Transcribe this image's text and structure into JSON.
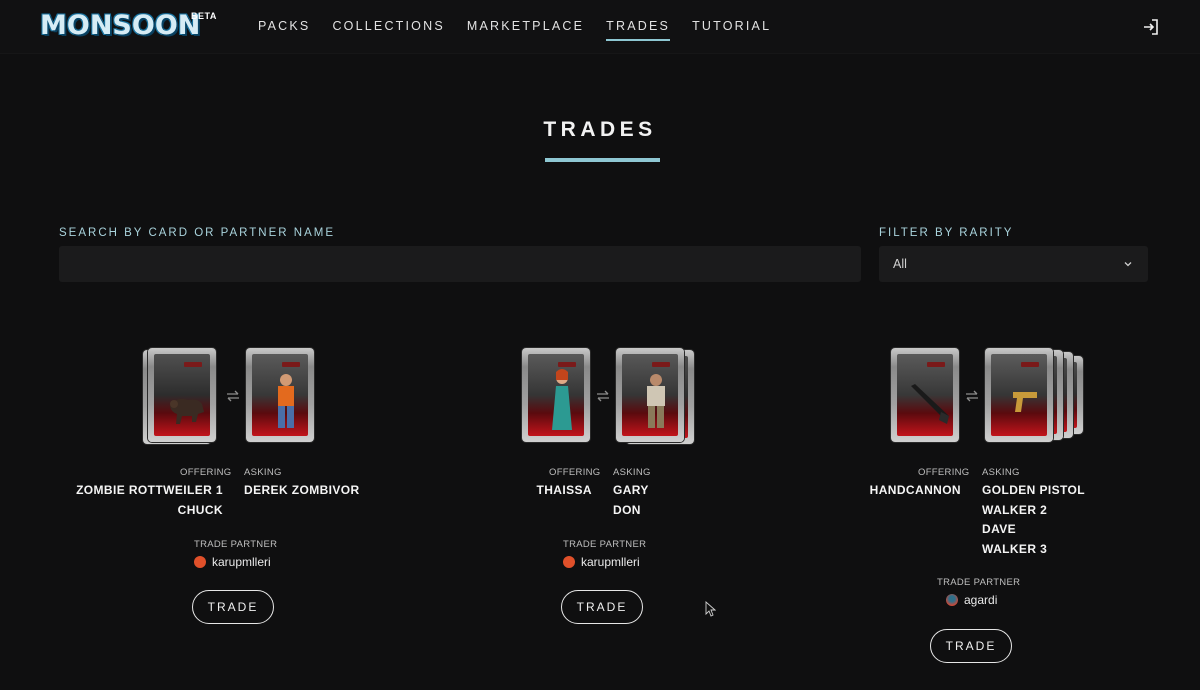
{
  "header": {
    "logo": "MONSOON",
    "beta": "BETA",
    "nav": [
      {
        "label": "PACKS",
        "active": false
      },
      {
        "label": "COLLECTIONS",
        "active": false
      },
      {
        "label": "MARKETPLACE",
        "active": false
      },
      {
        "label": "TRADES",
        "active": true
      },
      {
        "label": "TUTORIAL",
        "active": false
      }
    ],
    "login_icon": "sign-in-icon"
  },
  "page": {
    "title": "TRADES",
    "accent_color": "#8ec7d2"
  },
  "filters": {
    "search_label": "SEARCH BY CARD OR PARTNER NAME",
    "search_value": "",
    "search_placeholder": "",
    "rarity_label": "FILTER BY RARITY",
    "rarity_value": "All",
    "rarity_icon": "chevron-down-icon"
  },
  "trades": [
    {
      "offering_label": "OFFERING",
      "asking_label": "ASKING",
      "offering": [
        "ZOMBIE ROTTWEILER 1",
        "CHUCK"
      ],
      "asking": [
        "DEREK ZOMBIVOR"
      ],
      "partner_label": "TRADE PARTNER",
      "partner": "karupmlleri",
      "partner_avatar_color": "#e0502a",
      "button": "TRADE"
    },
    {
      "offering_label": "OFFERING",
      "asking_label": "ASKING",
      "offering": [
        "THAISSA"
      ],
      "asking": [
        "GARY",
        "DON"
      ],
      "partner_label": "TRADE PARTNER",
      "partner": "karupmlleri",
      "partner_avatar_color": "#e0502a",
      "button": "TRADE"
    },
    {
      "offering_label": "OFFERING",
      "asking_label": "ASKING",
      "offering": [
        "HANDCANNON"
      ],
      "asking": [
        "GOLDEN PISTOL",
        "WALKER 2",
        "DAVE",
        "WALKER 3"
      ],
      "partner_label": "TRADE PARTNER",
      "partner": "agardi",
      "partner_avatar_color": "#c94a3a",
      "button": "TRADE"
    }
  ]
}
